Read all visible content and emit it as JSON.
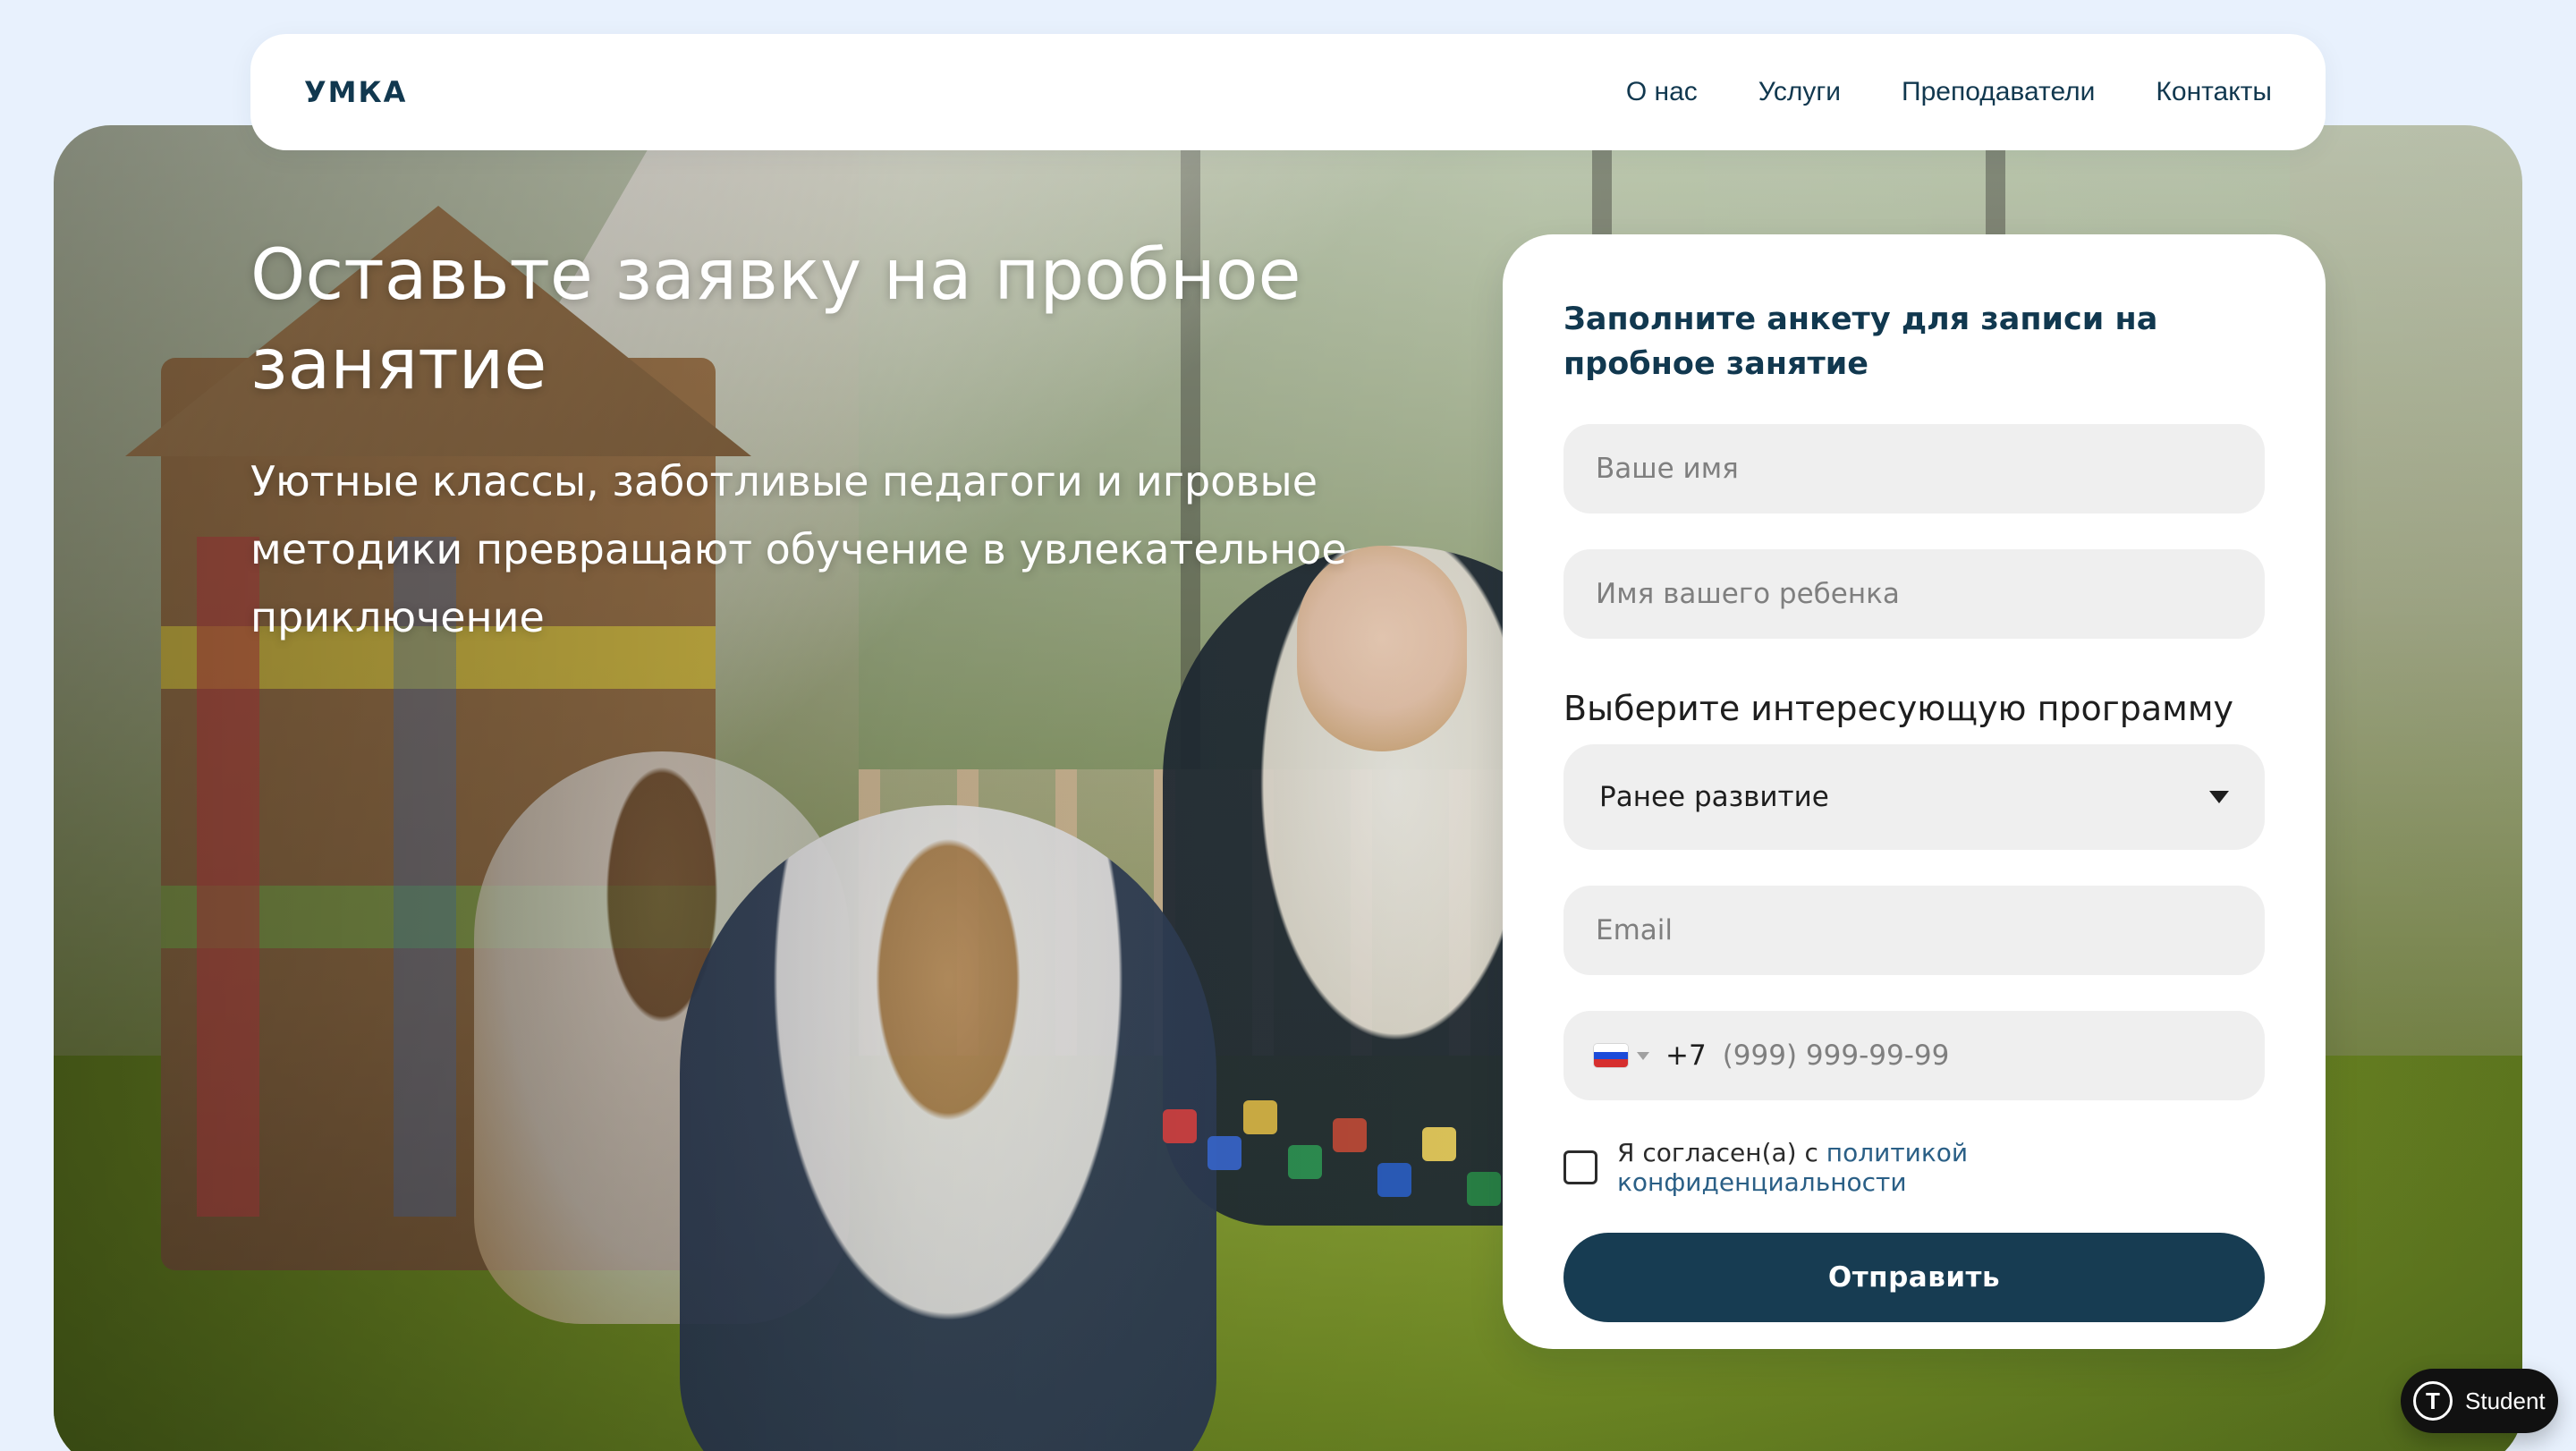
{
  "header": {
    "logo": "УМКА",
    "nav": [
      {
        "label": "О нас"
      },
      {
        "label": "Услуги"
      },
      {
        "label": "Преподаватели"
      },
      {
        "label": "Контакты"
      }
    ]
  },
  "hero": {
    "title": "Оставьте заявку на пробное занятие",
    "subtitle": "Уютные классы, заботливые педагоги и игровые методики превращают обучение в увлекательное приключение"
  },
  "form": {
    "title": "Заполните анкету для записи на пробное занятие",
    "name_placeholder": "Ваше имя",
    "child_name_placeholder": "Имя вашего ребенка",
    "program_label": "Выберите интересующую программу",
    "program_selected": "Ранее развитие",
    "email_placeholder": "Email",
    "phone_prefix": "+7",
    "phone_placeholder": "(999) 999-99-99",
    "consent_text": "Я согласен(а) с",
    "privacy_link": "политикой конфиденциальности",
    "submit_label": "Отправить"
  },
  "student_badge": {
    "icon_letter": "T",
    "label": "Student"
  },
  "colors": {
    "page_bg": "#e8f1fd",
    "brand_dark": "#11384f",
    "button_bg": "#173c52",
    "input_bg": "#efefef",
    "link": "#2a5f86"
  },
  "icons": {
    "dropdown": "chevron-down-icon",
    "flag": "russia-flag-icon",
    "student_badge": "student-icon"
  }
}
